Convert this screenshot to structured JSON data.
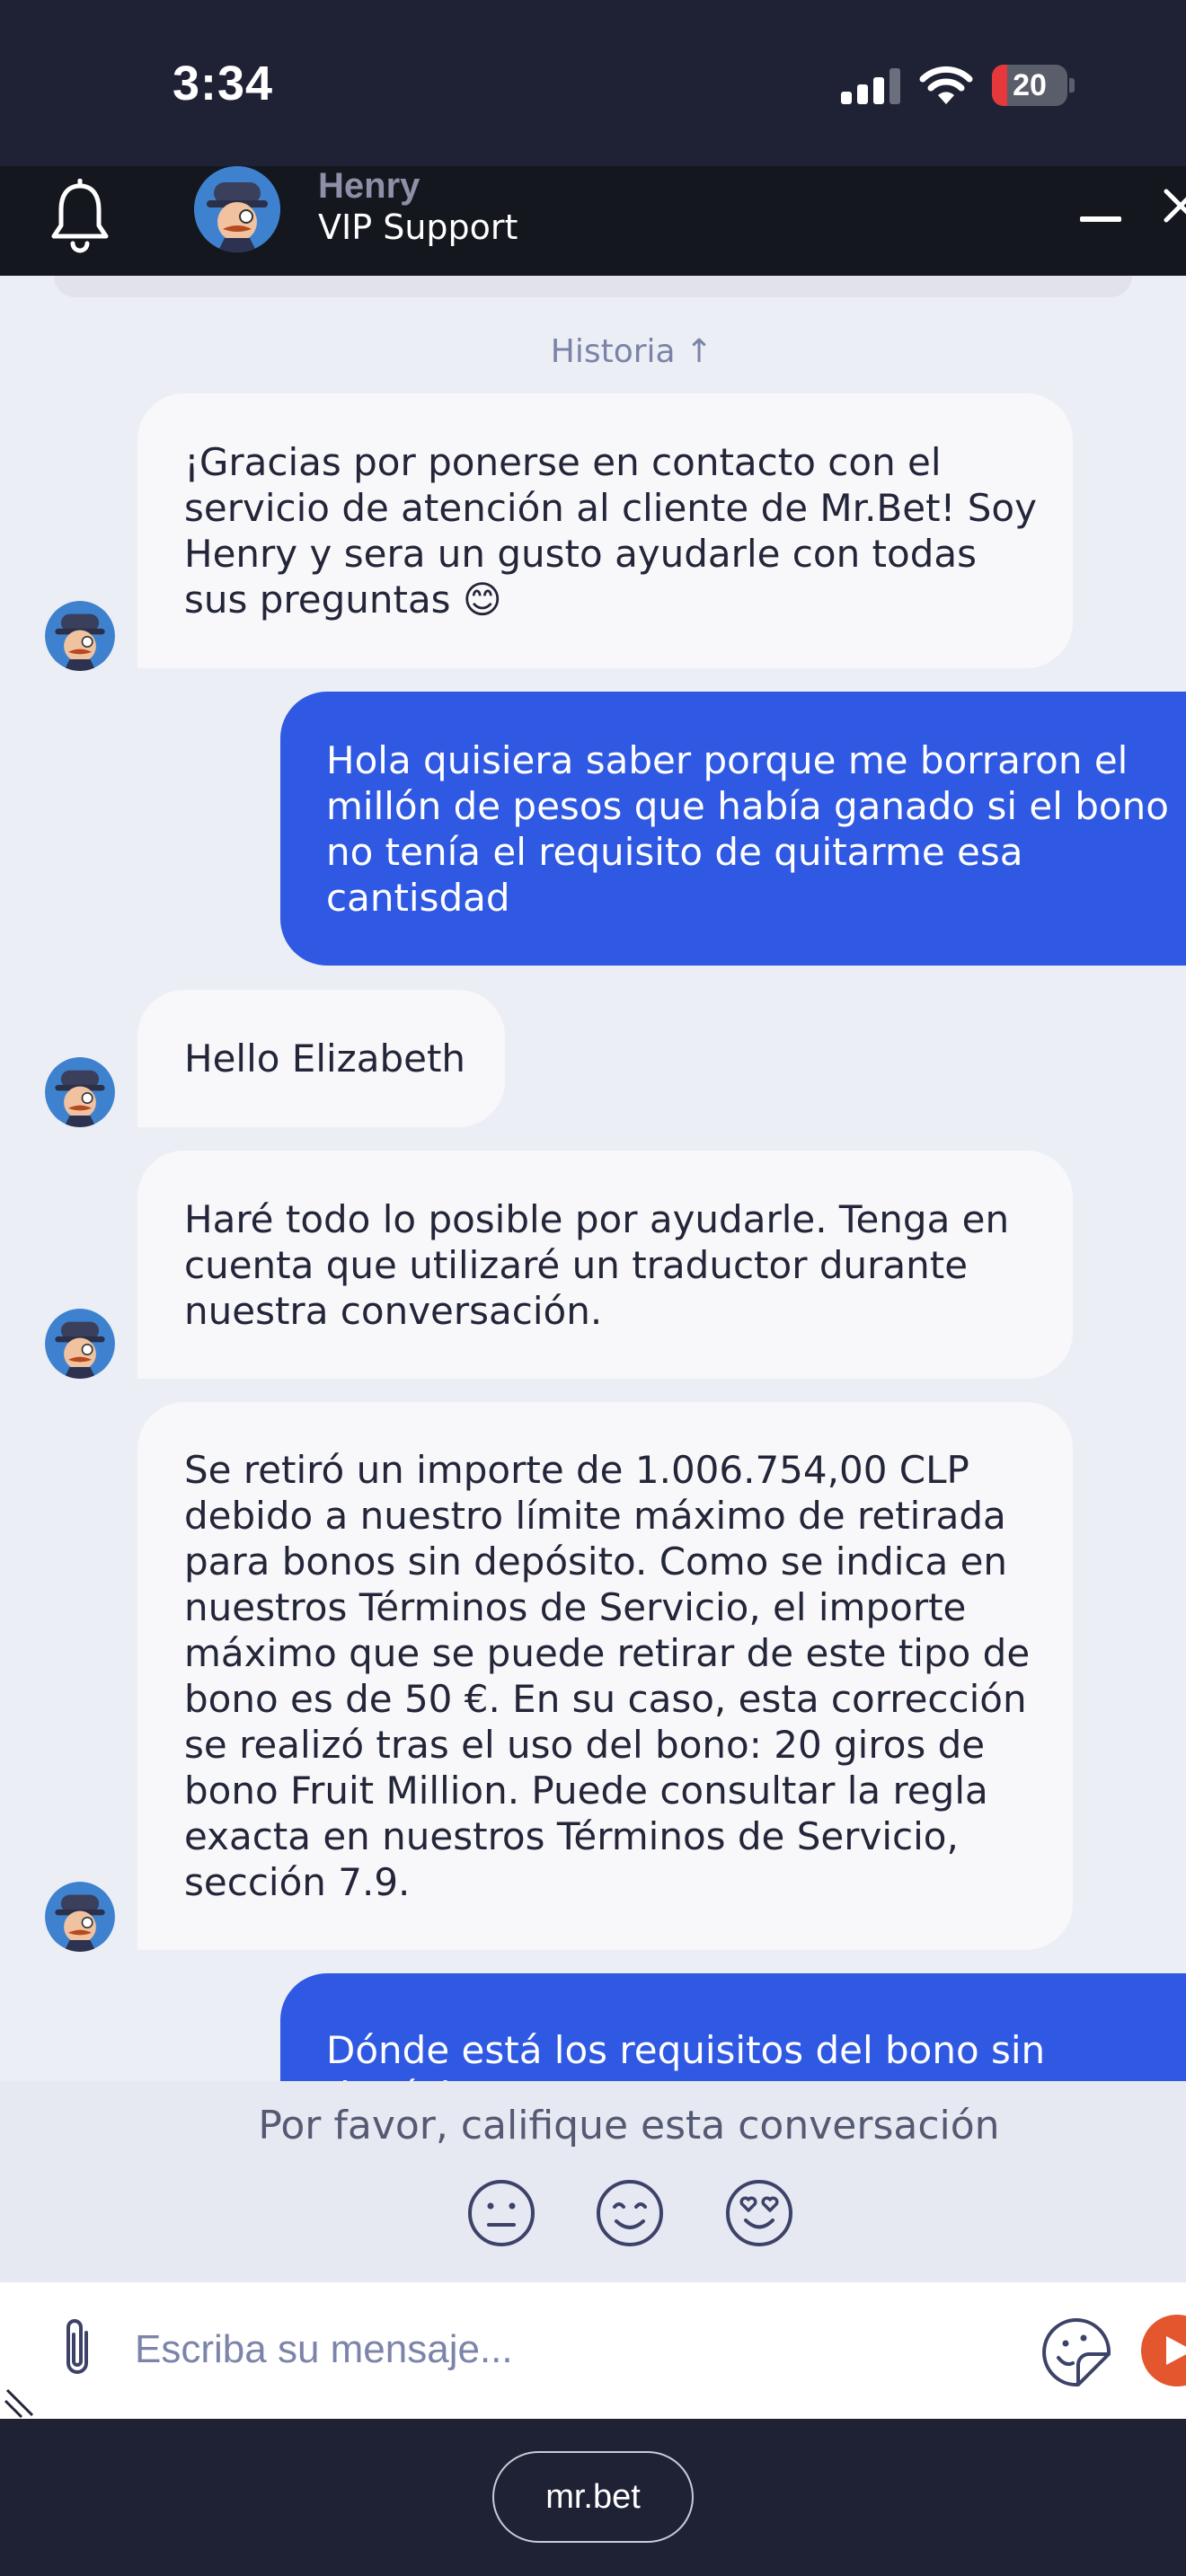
{
  "status_bar": {
    "time": "3:34",
    "battery": "20",
    "battery_level": 0.2
  },
  "header": {
    "agent_name": "Henry",
    "agent_role": "VIP Support"
  },
  "chat": {
    "history_label": "Historia ↑",
    "messages": [
      {
        "sender": "agent",
        "text": "¡Gracias por ponerse en contacto con el\nservicio de atención al cliente de Mr.Bet! Soy\nHenry y sera un gusto ayudarle con todas\nsus preguntas 😊"
      },
      {
        "sender": "user",
        "text": "Hola quisiera saber porque me borraron el\nmillón de pesos que había ganado si el bono\nno tenía el requisito de quitarme esa\ncantisdad"
      },
      {
        "sender": "agent",
        "text": "Hello Elizabeth"
      },
      {
        "sender": "agent",
        "text": "Haré todo lo posible por ayudarle. Tenga en\ncuenta que utilizaré un traductor durante\nnuestra conversación."
      },
      {
        "sender": "agent",
        "text": "Se retiró un importe de 1.006.754,00 CLP\ndebido a nuestro límite máximo de retirada\npara bonos sin depósito. Como se indica en\nnuestros Términos de Servicio, el importe\nmáximo que se puede retirar de este tipo de\nbono es de 50 €. En su caso, esta corrección\nse realizó tras el uso del bono: 20 giros de\nbono Fruit Million. Puede consultar la regla\nexacta en nuestros Términos de Servicio,\nsección 7.9."
      },
      {
        "sender": "user",
        "text": "Dónde está los requisitos del bono sin\ndepósito????"
      }
    ]
  },
  "rating": {
    "prompt": "Por favor, califique esta conversación",
    "options": [
      "neutral-face-icon",
      "smile-face-icon",
      "heart-eyes-face-icon"
    ]
  },
  "composer": {
    "placeholder": "Escriba su mensaje..."
  },
  "browser": {
    "url": "mr.bet"
  },
  "colors": {
    "user_bubble": "#2f58e3",
    "agent_bubble": "#f8f8fb",
    "chat_bg": "#eceef6",
    "send": "#e4572e",
    "header_bg": "#15171f"
  }
}
